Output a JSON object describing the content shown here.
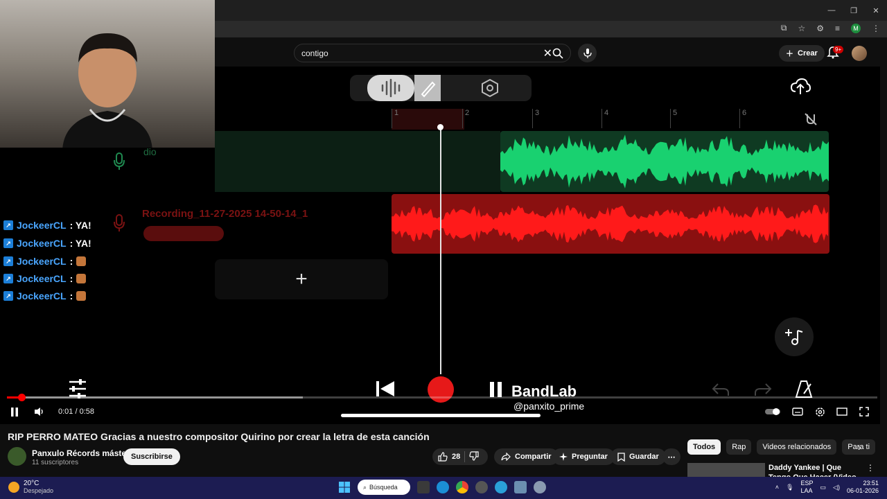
{
  "browser": {
    "window_controls": [
      "—",
      "❐",
      "✕"
    ],
    "profile_initial": "M"
  },
  "youtube": {
    "search": {
      "value": "contigo"
    },
    "create_label": "Crear",
    "notif_badge": "9+",
    "player": {
      "time": "0:01 / 0:58",
      "played_fraction": 0.017,
      "buffered_fraction": 0.34
    },
    "video": {
      "title": "RIP PERRO MATEO Gracias a nuestro compositor Quirino por crear la letra de esta canción",
      "channel": "Panxulo Récords máster",
      "subscribers": "11 suscriptores",
      "subscribe_label": "Suscribirse",
      "likes": "28",
      "share_label": "Compartir",
      "ask_label": "Preguntar",
      "save_label": "Guardar"
    },
    "chips": [
      "Todos",
      "Rap",
      "Videos relacionados",
      "Para ti"
    ],
    "recommended": {
      "title": "Daddy Yankee | Que Tengo Que Hacer (Video Oficial)"
    }
  },
  "daw": {
    "ruler_ticks": [
      "1",
      "2",
      "3",
      "4",
      "5",
      "6"
    ],
    "track1_label": "dio",
    "track2_label": "Recording_11-27-2025 14-50-14_1",
    "watermark": {
      "logo": "BandLab",
      "handle": "@panxito_prime"
    }
  },
  "chat": {
    "messages": [
      {
        "user": "JockeerCL",
        "text": ": YA!"
      },
      {
        "user": "JockeerCL",
        "text": ": YA!"
      },
      {
        "user": "JockeerCL",
        "text": ":"
      },
      {
        "user": "JockeerCL",
        "text": ":"
      },
      {
        "user": "JockeerCL",
        "text": ":"
      }
    ]
  },
  "taskbar": {
    "temp": "20°C",
    "weather": "Despejado",
    "search_label": "Búsqueda",
    "lang1": "ESP",
    "lang2": "LAA",
    "time": "23:51",
    "date": "06-01-2026"
  },
  "colors": {
    "yt_red": "#ff0000",
    "track_green": "#19d170",
    "track_red": "#ff1a1a",
    "taskbar": "#1c1c52"
  }
}
